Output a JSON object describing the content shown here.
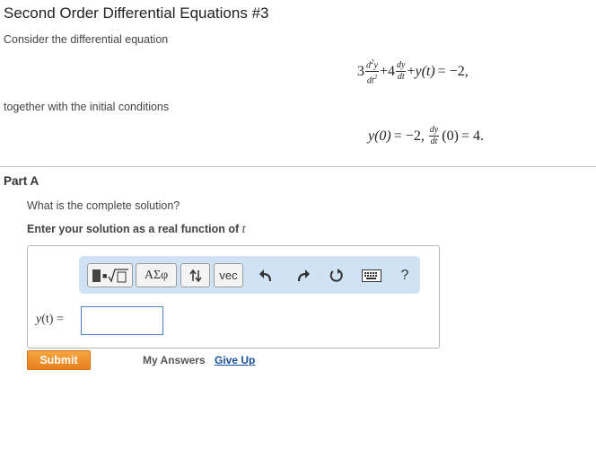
{
  "title": "Second Order Differential Equations #3",
  "intro": "Consider the differential equation",
  "equation": {
    "coef1": "3",
    "d2y_num": "d",
    "d2y_num_var": "y",
    "d2y_den": "dt",
    "sq": "2",
    "plus1": "+4",
    "dy_num": "dy",
    "dy_den": "dt",
    "plus2": "+",
    "yt": "y(t)",
    "rhs": "= −2,"
  },
  "conditions_intro": "together with the initial conditions",
  "conditions": {
    "y0": "y(0)",
    "y0_val": "= −2,",
    "dy_num": "dy",
    "dy_den": "dt",
    "dy_arg": "(0)",
    "dy_val": "= 4."
  },
  "part_label": "Part A",
  "question": "What is the complete solution?",
  "instruction": "Enter your solution as a real function of",
  "instruction_var": "t",
  "toolbar": {
    "templates_icon": "sqrt-template-icon",
    "greek_label": "ΑΣφ",
    "sort_icon": "up-down-arrows-icon",
    "vec_label": "vec",
    "undo_icon": "undo-icon",
    "redo_icon": "redo-icon",
    "reset_icon": "reset-icon",
    "keyboard_icon": "keyboard-icon",
    "help_label": "?"
  },
  "answer": {
    "label_var": "y",
    "label_arg": "(t)",
    "label_eq": "=",
    "value": ""
  },
  "submit_label": "Submit",
  "my_answers_label": "My Answers",
  "give_up_label": "Give Up",
  "colors": {
    "submit": "#e8801b",
    "toolbar_bg": "#cfe3f5",
    "link": "#1a4f9c",
    "input_border": "#4a7fc0"
  }
}
